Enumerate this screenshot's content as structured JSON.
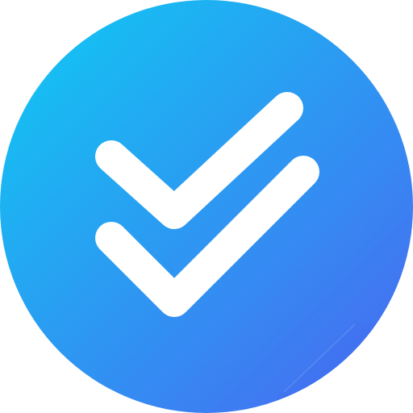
{
  "icon": {
    "name": "double-check-icon",
    "colors": {
      "gradient_start": "#0ECBF3",
      "gradient_end": "#4B66F1",
      "check_stroke": "#FFFFFF"
    }
  }
}
